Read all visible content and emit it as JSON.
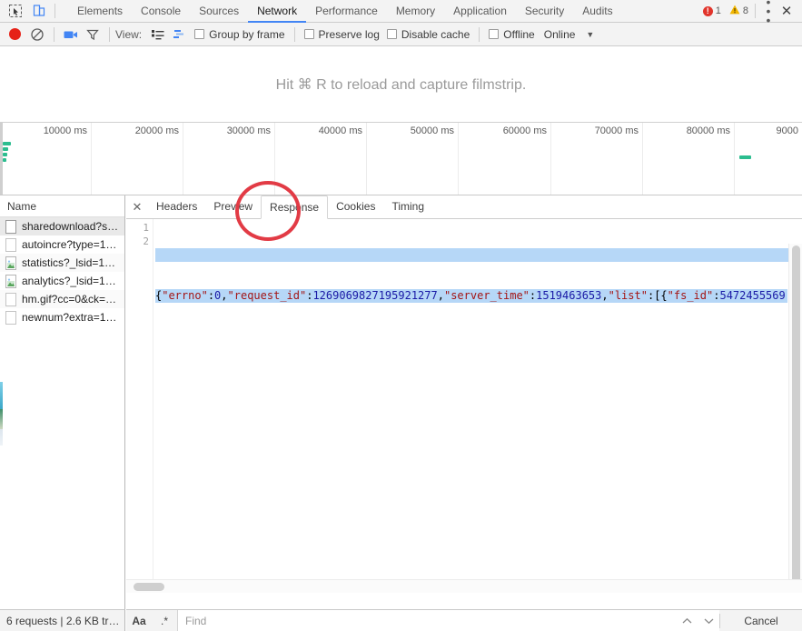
{
  "window": {
    "devtools_tabs": [
      {
        "label": "Elements",
        "active": false
      },
      {
        "label": "Console",
        "active": false
      },
      {
        "label": "Sources",
        "active": false
      },
      {
        "label": "Network",
        "active": true
      },
      {
        "label": "Performance",
        "active": false
      },
      {
        "label": "Memory",
        "active": false
      },
      {
        "label": "Application",
        "active": false
      },
      {
        "label": "Security",
        "active": false
      },
      {
        "label": "Audits",
        "active": false
      }
    ],
    "error_count": "1",
    "warning_count": "8",
    "inspect_icon": "inspect-element-icon",
    "device_icon": "device-toolbar-icon",
    "more_icon": "vertical-dots-icon",
    "close_icon": "close-icon"
  },
  "network_toolbar": {
    "record_icon": "record-icon",
    "clear_icon": "clear-icon",
    "filmstrip_icon": "camera-icon",
    "filter_icon": "filter-funnel-icon",
    "view_label": "View:",
    "view_list_icon": "list-view-icon",
    "view_waterfall_icon": "waterfall-view-icon",
    "group_by_frame": "Group by frame",
    "preserve_log": "Preserve log",
    "disable_cache": "Disable cache",
    "offline": "Offline",
    "throttling_value": "Online",
    "throttling_caret": "chevron-down-icon"
  },
  "filmstrip": {
    "message": "Hit ⌘ R to reload and capture filmstrip."
  },
  "overview": {
    "tick_labels": [
      "10000 ms",
      "20000 ms",
      "30000 ms",
      "40000 ms",
      "50000 ms",
      "60000 ms",
      "70000 ms",
      "80000 ms",
      "9000"
    ]
  },
  "requests_panel": {
    "column_header": "Name",
    "rows": [
      {
        "name": "sharedownload?s…",
        "icon": "document-icon",
        "selected": true
      },
      {
        "name": "autoincre?type=1…",
        "icon": "document-icon",
        "selected": false
      },
      {
        "name": "statistics?_lsid=1…",
        "icon": "image-document-icon",
        "selected": false
      },
      {
        "name": "analytics?_lsid=1…",
        "icon": "image-document-icon",
        "selected": false
      },
      {
        "name": "hm.gif?cc=0&ck=…",
        "icon": "document-icon",
        "selected": false
      },
      {
        "name": "newnum?extra=1…",
        "icon": "document-icon",
        "selected": false
      }
    ],
    "status": "6 requests | 2.6 KB tr…"
  },
  "detail_panel": {
    "close_icon": "close-icon",
    "tabs": [
      {
        "label": "Headers",
        "active": false
      },
      {
        "label": "Preview",
        "active": false
      },
      {
        "label": "Response",
        "active": true
      },
      {
        "label": "Cookies",
        "active": false
      },
      {
        "label": "Timing",
        "active": false
      }
    ],
    "line_numbers": [
      "1",
      "2"
    ],
    "response_segments": [
      {
        "text": "{",
        "kind": "p"
      },
      {
        "text": "\"errno\"",
        "kind": "k"
      },
      {
        "text": ":",
        "kind": "p"
      },
      {
        "text": "0",
        "kind": "n"
      },
      {
        "text": ",",
        "kind": "p"
      },
      {
        "text": "\"request_id\"",
        "kind": "k"
      },
      {
        "text": ":",
        "kind": "p"
      },
      {
        "text": "1269069827195921277",
        "kind": "n"
      },
      {
        "text": ",",
        "kind": "p"
      },
      {
        "text": "\"server_time\"",
        "kind": "k"
      },
      {
        "text": ":",
        "kind": "p"
      },
      {
        "text": "1519463653",
        "kind": "n"
      },
      {
        "text": ",",
        "kind": "p"
      },
      {
        "text": "\"list\"",
        "kind": "k"
      },
      {
        "text": ":[{",
        "kind": "p"
      },
      {
        "text": "\"fs_id\"",
        "kind": "k"
      },
      {
        "text": ":",
        "kind": "p"
      },
      {
        "text": "5472455569",
        "kind": "n"
      }
    ]
  },
  "find_bar": {
    "match_case_label": "Aa",
    "regex_label": ".*",
    "placeholder": "Find",
    "value": "",
    "prev_icon": "chevron-up-icon",
    "next_icon": "chevron-down-icon",
    "cancel_label": "Cancel"
  },
  "colors": {
    "accent": "#4285f4",
    "record_red": "#e62117",
    "annotation_red": "#e23b45",
    "request_bar_green": "#2cbd8f",
    "selection_blue": "#b6d7f7"
  }
}
